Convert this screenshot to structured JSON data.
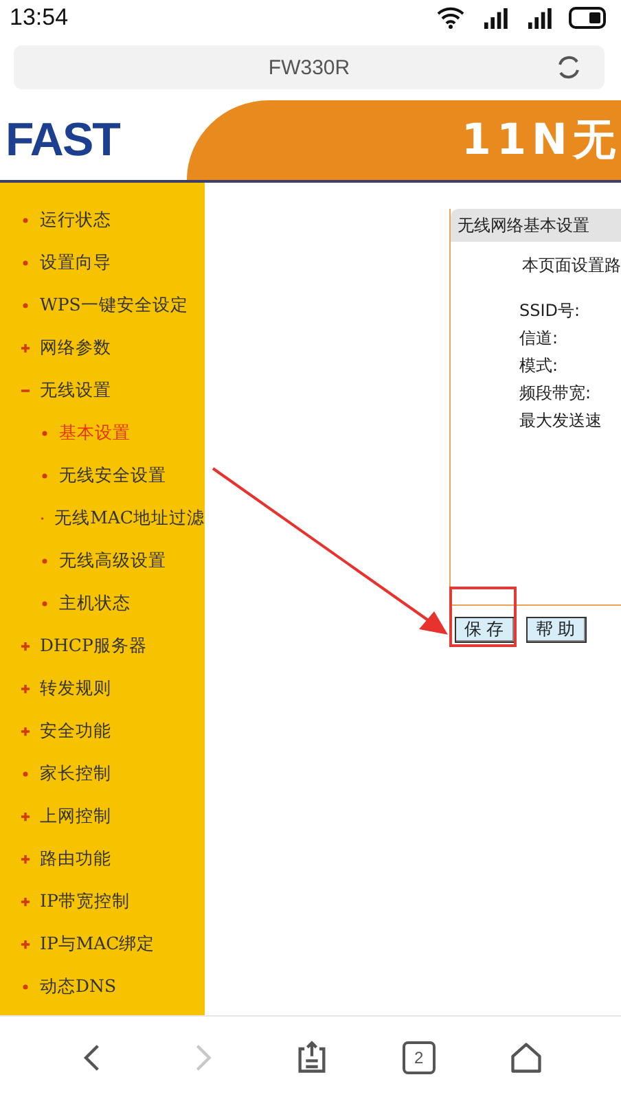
{
  "status_bar": {
    "time": "13:54"
  },
  "address_bar": {
    "title": "FW330R"
  },
  "header": {
    "logo": "FAST",
    "banner": "11N无"
  },
  "sidebar": {
    "items": [
      {
        "label": "运行状态",
        "kind": "bullet",
        "selected": false
      },
      {
        "label": "设置向导",
        "kind": "bullet",
        "selected": false
      },
      {
        "label": "WPS一键安全设定",
        "kind": "bullet",
        "selected": false
      },
      {
        "label": "网络参数",
        "kind": "plus",
        "selected": false
      },
      {
        "label": "无线设置",
        "kind": "minus",
        "selected": false,
        "children": [
          {
            "label": "基本设置",
            "kind": "bullet",
            "selected": true
          },
          {
            "label": "无线安全设置",
            "kind": "bullet",
            "selected": false
          },
          {
            "label": "无线MAC地址过滤",
            "kind": "bullet",
            "selected": false
          },
          {
            "label": "无线高级设置",
            "kind": "bullet",
            "selected": false
          },
          {
            "label": "主机状态",
            "kind": "bullet",
            "selected": false
          }
        ]
      },
      {
        "label": "DHCP服务器",
        "kind": "plus",
        "selected": false
      },
      {
        "label": "转发规则",
        "kind": "plus",
        "selected": false
      },
      {
        "label": "安全功能",
        "kind": "plus",
        "selected": false
      },
      {
        "label": "家长控制",
        "kind": "bullet",
        "selected": false
      },
      {
        "label": "上网控制",
        "kind": "plus",
        "selected": false
      },
      {
        "label": "路由功能",
        "kind": "plus",
        "selected": false
      },
      {
        "label": "IP带宽控制",
        "kind": "plus",
        "selected": false
      },
      {
        "label": "IP与MAC绑定",
        "kind": "plus",
        "selected": false
      },
      {
        "label": "动态DNS",
        "kind": "bullet",
        "selected": false
      }
    ]
  },
  "panel": {
    "title": "无线网络基本设置",
    "intro": "本页面设置路",
    "fields": [
      "SSID号:",
      "信道:",
      "模式:",
      "频段带宽:",
      "最大发送速"
    ],
    "buttons": [
      {
        "label": "保存",
        "highlighted": true
      },
      {
        "label": "帮助",
        "highlighted": false
      }
    ]
  },
  "nav_bar": {
    "items": [
      {
        "kind": "back",
        "disabled": false
      },
      {
        "kind": "forward",
        "disabled": true
      },
      {
        "kind": "share",
        "disabled": false
      },
      {
        "kind": "tabs",
        "count": "2",
        "disabled": false
      },
      {
        "kind": "home",
        "disabled": false
      }
    ]
  }
}
